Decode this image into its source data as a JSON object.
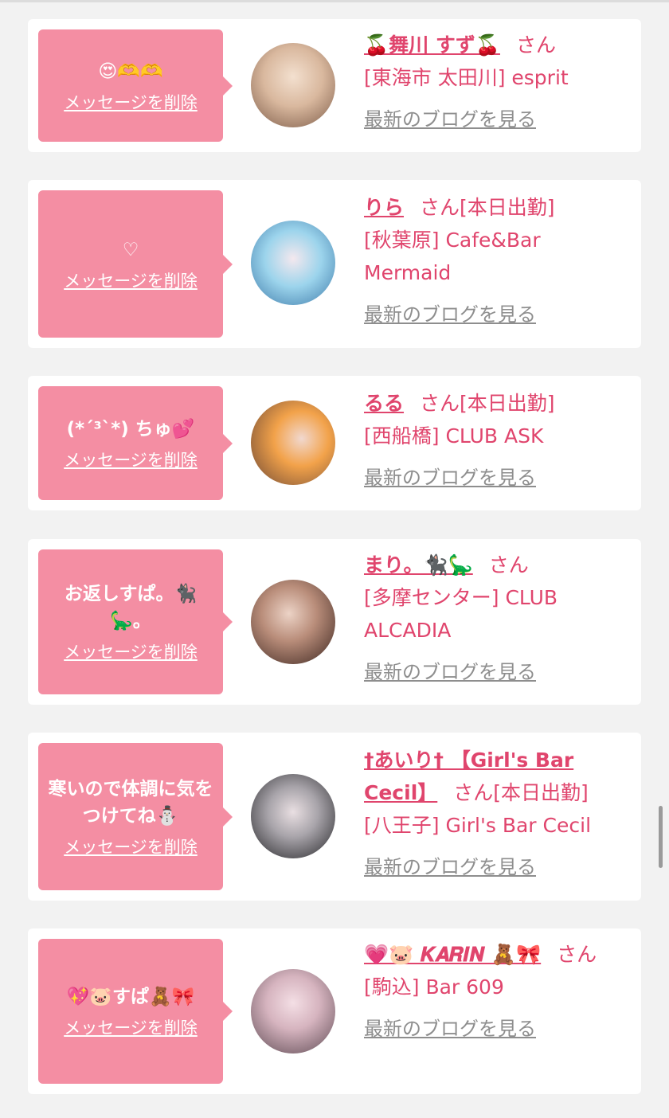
{
  "delete_label": "メッセージを削除",
  "blog_label": "最新のブログを見る",
  "san_label": "さん",
  "colors": {
    "bubble": "#f48ea3",
    "accent": "#e0456d",
    "muted": "#8e8e8e",
    "background": "#f2f2f2"
  },
  "items": [
    {
      "message": "😍🫶🫶",
      "name": "🍒舞川 すず🍒",
      "status": "",
      "shop": "[東海市 太田川] esprit",
      "avatar_colors": [
        "#e9d3c0",
        "#9b7a66"
      ]
    },
    {
      "message": "♡",
      "name": "りら",
      "status": "[本日出勤]",
      "shop": "[秋葉原] Cafe&Bar Mermaid",
      "avatar_colors": [
        "#bfe4f2",
        "#3a6f9a"
      ]
    },
    {
      "message": "(*´³`*) ちゅ💕",
      "name": "るる",
      "status": "[本日出勤]",
      "shop": "[西船橋] CLUB ASK",
      "avatar_colors": [
        "#f5a64a",
        "#6b4a3a"
      ]
    },
    {
      "message": "お返しすぱ。🐈‍⬛🦕。",
      "name": "まり。🐈‍⬛🦕",
      "status": "",
      "shop": "[多摩センター] CLUB ALCADIA",
      "avatar_colors": [
        "#c79a86",
        "#3b2620"
      ]
    },
    {
      "message": "寒いので体調に気をつけてね⛄️",
      "name": "†あいり† 【Girl's Bar Cecil】",
      "status": "[本日出勤]",
      "shop": "[八王子] Girl's Bar Cecil",
      "avatar_colors": [
        "#cfcfd4",
        "#2b2b30"
      ]
    },
    {
      "message": "💖🐷すぱ🧸🎀",
      "name": "💗🐷 𝑲𝑨𝑹𝑰𝑵 🧸🎀",
      "status": "",
      "shop": "[駒込] Bar 609",
      "avatar_colors": [
        "#e9c7cf",
        "#6d5560"
      ]
    }
  ]
}
